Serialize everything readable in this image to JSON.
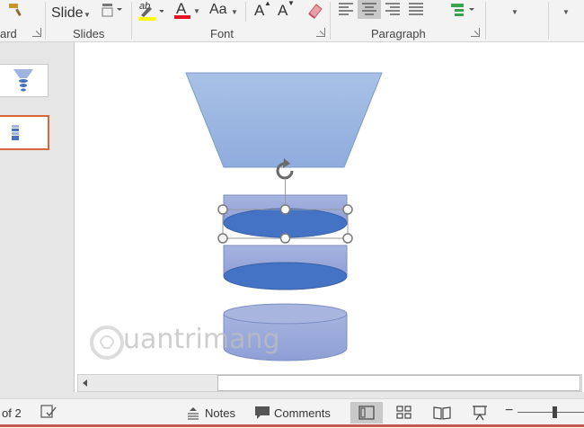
{
  "ribbon": {
    "groups": {
      "clipboard_label": "ard",
      "slides_label": "Slides",
      "font_label": "Font",
      "paragraph_label": "Paragraph"
    },
    "slide_button_label": "Slide",
    "font_case_label": "Aa",
    "grow_font_label": "A",
    "shrink_font_label": "A",
    "font_color_label": "A",
    "highlight_label": "ab",
    "colors": {
      "highlight": "#ffff00",
      "font_color": "#e81123"
    }
  },
  "thumbnails": {
    "selected_index": 2,
    "selected_border": "#d9653b"
  },
  "slide": {
    "shape_fill": "#9fb3e0",
    "ellipse_fill": "#4472c4",
    "watermark": "uantrimang"
  },
  "statusbar": {
    "slide_counter": "of 2",
    "notes_label": "Notes",
    "comments_label": "Comments"
  }
}
